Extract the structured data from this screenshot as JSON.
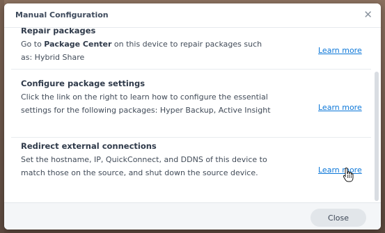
{
  "dialog": {
    "title": "Manual Configuration",
    "close_icon": "close-icon"
  },
  "sections": [
    {
      "title": "Repair packages",
      "desc_prefix": "Go to ",
      "desc_bold": "Package Center",
      "desc_suffix": " on this device to repair packages such as: Hybrid Share",
      "link": "Learn more"
    },
    {
      "title": "Configure package settings",
      "desc": "Click the link on the right to learn how to configure the essential settings for the following packages: Hyper Backup, Active Insight",
      "link": "Learn more"
    },
    {
      "title": "Redirect external connections",
      "desc": "Set the hostname, IP, QuickConnect, and DDNS of this device to match those on the source, and shut down the source device.",
      "link": "Learn more"
    }
  ],
  "footer": {
    "close_label": "Close"
  },
  "colors": {
    "link": "#0a76d8",
    "button_bg": "#e2e6ea",
    "footer_bg": "#f4f6f8"
  }
}
